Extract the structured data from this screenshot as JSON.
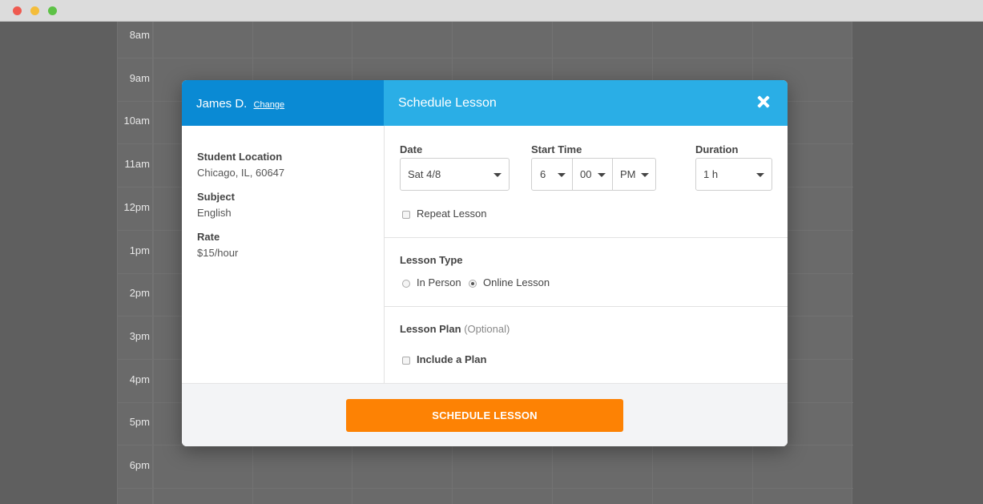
{
  "calendar": {
    "times": [
      "8am",
      "9am",
      "10am",
      "11am",
      "12pm",
      "1pm",
      "2pm",
      "3pm",
      "4pm",
      "5pm",
      "6pm"
    ]
  },
  "modal": {
    "student_name": "James D.",
    "change_link": "Change",
    "title": "Schedule Lesson",
    "close_icon": "close-icon",
    "info": [
      {
        "label": "Student Location",
        "value": "Chicago, IL, 60647"
      },
      {
        "label": "Subject",
        "value": "English"
      },
      {
        "label": "Rate",
        "value": "$15/hour"
      }
    ],
    "date": {
      "label": "Date",
      "value": "Sat 4/8"
    },
    "start_time": {
      "label": "Start Time",
      "hour": "6",
      "minute": "00",
      "ampm": "PM"
    },
    "duration": {
      "label": "Duration",
      "value": "1 h"
    },
    "repeat_lesson": {
      "label": "Repeat Lesson",
      "checked": false
    },
    "lesson_type": {
      "label": "Lesson Type",
      "options": [
        {
          "label": "In Person",
          "selected": false
        },
        {
          "label": "Online Lesson",
          "selected": true
        }
      ]
    },
    "lesson_plan": {
      "label": "Lesson Plan",
      "optional": "(Optional)",
      "include_label": "Include a Plan",
      "checked": false
    },
    "submit_label": "SCHEDULE LESSON"
  },
  "colors": {
    "left_header": "#0a8ad4",
    "right_header": "#2aaee6",
    "primary_button": "#fd8204"
  }
}
